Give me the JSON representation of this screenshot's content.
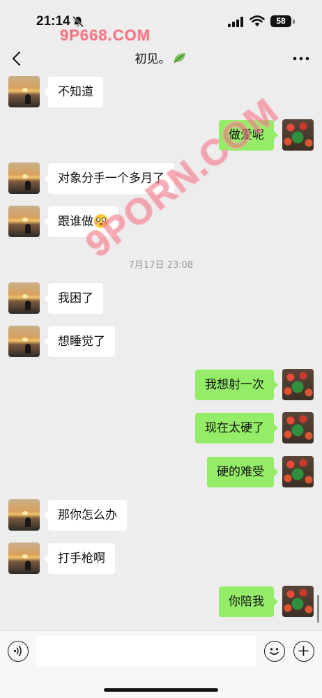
{
  "status_bar": {
    "time": "21:14",
    "battery": "58",
    "icons": [
      "bell-muted-icon",
      "signal-icon",
      "wifi-icon",
      "battery-icon"
    ]
  },
  "watermarks": {
    "top": "9P668.COM",
    "diagonal": "9PORN.COM"
  },
  "nav": {
    "title": "初见。",
    "back_icon": "chevron-left-icon",
    "title_icon": "leaf-icon",
    "more_icon": "more-dots-icon"
  },
  "messages": [
    {
      "side": "left",
      "text": "不知道"
    },
    {
      "side": "right",
      "text": "做爱呢"
    },
    {
      "side": "left",
      "text": "对象分手一个多月了"
    },
    {
      "side": "left",
      "text": "跟谁做",
      "emoji": "flushed-face-icon"
    },
    {
      "side": "left",
      "text": "我困了"
    },
    {
      "side": "left",
      "text": "想睡觉了"
    },
    {
      "side": "right",
      "text": "我想射一次"
    },
    {
      "side": "right",
      "text": "现在太硬了"
    },
    {
      "side": "right",
      "text": "硬的难受"
    },
    {
      "side": "left",
      "text": "那你怎么办"
    },
    {
      "side": "left",
      "text": "打手枪啊"
    },
    {
      "side": "right",
      "text": "你陪我"
    }
  ],
  "timestamp": "7月17日 23:08",
  "input_bar": {
    "value": "",
    "placeholder": "",
    "icons": [
      "voice-icon",
      "emoji-icon",
      "plus-icon"
    ]
  },
  "colors": {
    "background": "#ededed",
    "sent_bubble": "#95ec69",
    "received_bubble": "#ffffff",
    "watermark": "#f36a7a"
  }
}
